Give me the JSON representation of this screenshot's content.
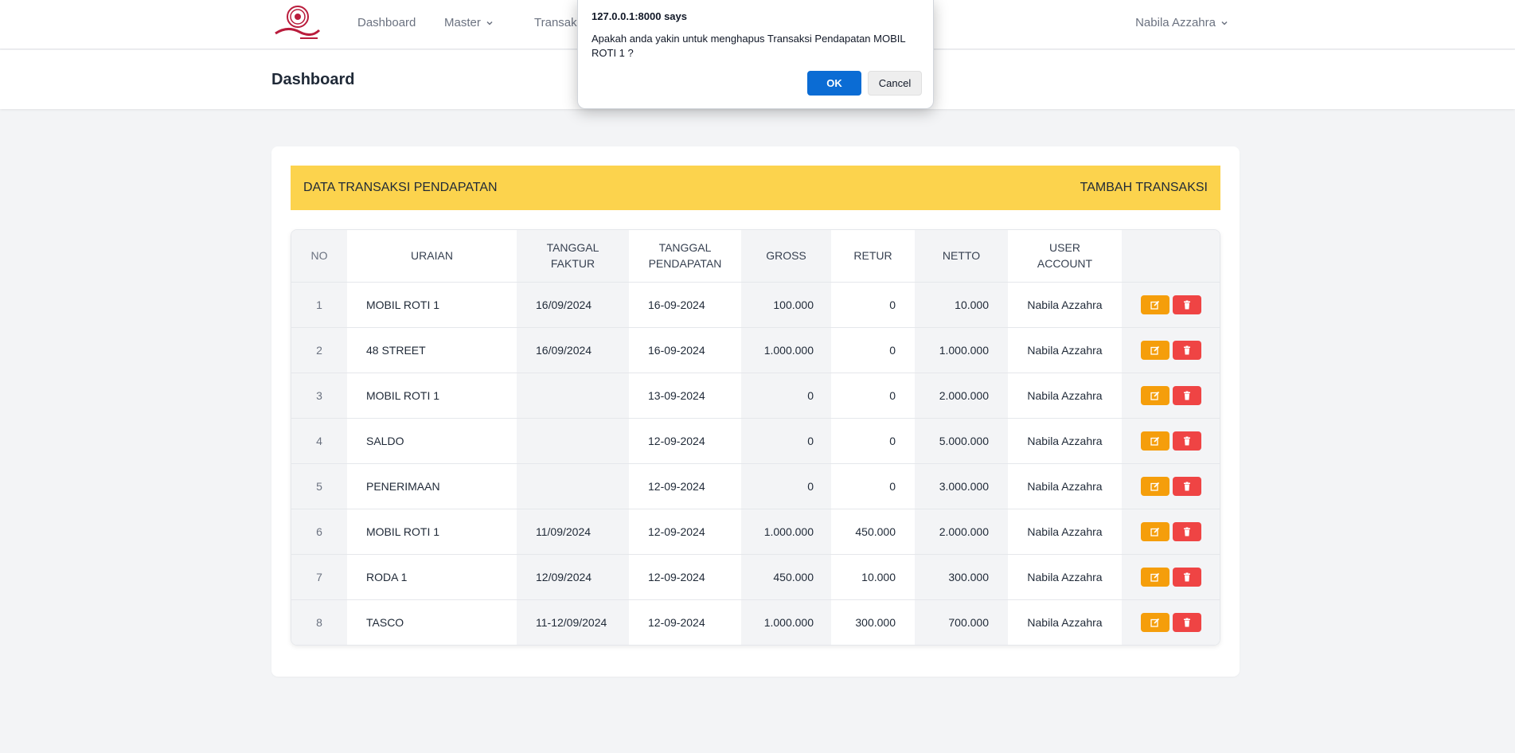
{
  "nav": {
    "logo_alt": "Roti logo",
    "items": [
      {
        "label": "Dashboard",
        "dropdown": false
      },
      {
        "label": "Master",
        "dropdown": true
      },
      {
        "label": "Transaksi",
        "dropdown": true
      }
    ],
    "user": "Nabila Azzahra"
  },
  "header": {
    "title": "Dashboard"
  },
  "card": {
    "banner_title": "DATA TRANSAKSI PENDAPATAN",
    "add_label": "TAMBAH TRANSAKSI",
    "columns": [
      "NO",
      "URAIAN",
      "TANGGAL FAKTUR",
      "TANGGAL PENDAPATAN",
      "GROSS",
      "RETUR",
      "NETTO",
      "USER ACCOUNT",
      ""
    ],
    "rows": [
      {
        "no": "1",
        "uraian": "MOBIL ROTI 1",
        "tgl_faktur": "16/09/2024",
        "tgl_pendapatan": "16-09-2024",
        "gross": "100.000",
        "retur": "0",
        "netto": "10.000",
        "user": "Nabila Azzahra"
      },
      {
        "no": "2",
        "uraian": "48 STREET",
        "tgl_faktur": "16/09/2024",
        "tgl_pendapatan": "16-09-2024",
        "gross": "1.000.000",
        "retur": "0",
        "netto": "1.000.000",
        "user": "Nabila Azzahra"
      },
      {
        "no": "3",
        "uraian": "MOBIL ROTI 1",
        "tgl_faktur": "",
        "tgl_pendapatan": "13-09-2024",
        "gross": "0",
        "retur": "0",
        "netto": "2.000.000",
        "user": "Nabila Azzahra"
      },
      {
        "no": "4",
        "uraian": "SALDO",
        "tgl_faktur": "",
        "tgl_pendapatan": "12-09-2024",
        "gross": "0",
        "retur": "0",
        "netto": "5.000.000",
        "user": "Nabila Azzahra"
      },
      {
        "no": "5",
        "uraian": "PENERIMAAN",
        "tgl_faktur": "",
        "tgl_pendapatan": "12-09-2024",
        "gross": "0",
        "retur": "0",
        "netto": "3.000.000",
        "user": "Nabila Azzahra"
      },
      {
        "no": "6",
        "uraian": "MOBIL ROTI 1",
        "tgl_faktur": "11/09/2024",
        "tgl_pendapatan": "12-09-2024",
        "gross": "1.000.000",
        "retur": "450.000",
        "netto": "2.000.000",
        "user": "Nabila Azzahra"
      },
      {
        "no": "7",
        "uraian": "RODA 1",
        "tgl_faktur": "12/09/2024",
        "tgl_pendapatan": "12-09-2024",
        "gross": "450.000",
        "retur": "10.000",
        "netto": "300.000",
        "user": "Nabila Azzahra"
      },
      {
        "no": "8",
        "uraian": "TASCO",
        "tgl_faktur": "11-12/09/2024",
        "tgl_pendapatan": "12-09-2024",
        "gross": "1.000.000",
        "retur": "300.000",
        "netto": "700.000",
        "user": "Nabila Azzahra"
      }
    ]
  },
  "dialog": {
    "title": "127.0.0.1:8000 says",
    "message": "Apakah anda yakin untuk menghapus Transaksi Pendapatan MOBIL ROTI 1 ?",
    "ok_label": "OK",
    "cancel_label": "Cancel"
  },
  "colors": {
    "banner": "#fcd34d",
    "edit_button": "#f59e0b",
    "delete_button": "#ef4444",
    "dialog_ok": "#0b6cd4"
  },
  "icons": {
    "edit": "edit-icon",
    "delete": "trash-icon",
    "dropdown": "chevron-down-icon"
  }
}
